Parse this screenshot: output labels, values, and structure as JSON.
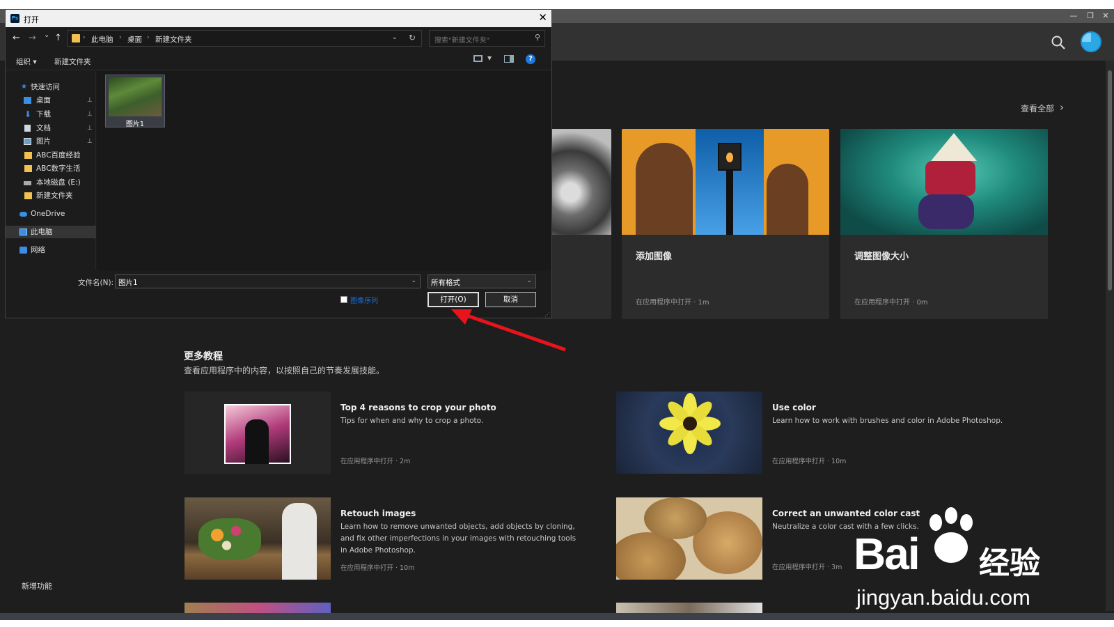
{
  "window": {
    "minimize_glyph": "—",
    "restore_glyph": "❐",
    "close_glyph": "✕"
  },
  "home": {
    "see_all": "查看全部",
    "cards": [
      {
        "title": "添加图像",
        "meta": "在应用程序中打开 · 1m"
      },
      {
        "title": "调整图像大小",
        "meta": "在应用程序中打开 · 0m"
      }
    ],
    "more_title": "更多教程",
    "more_subtitle": "查看应用程序中的内容，以按照自己的节奏发展技能。",
    "tutorials": [
      {
        "title": "Top 4 reasons to crop your photo",
        "desc": "Tips for when and why to crop a photo.",
        "meta": "在应用程序中打开 · 2m"
      },
      {
        "title": "Use color",
        "desc": "Learn how to work with brushes and color in Adobe Photoshop.",
        "meta": "在应用程序中打开 · 10m"
      },
      {
        "title": "Retouch images",
        "desc": "Learn how to remove unwanted objects, add objects by cloning, and fix other imperfections in your images with retouching tools in Adobe Photoshop.",
        "meta": "在应用程序中打开 · 10m"
      },
      {
        "title": "Correct an unwanted color cast",
        "desc": "Neutralize a color cast with a few clicks.",
        "meta": "在应用程序中打开 · 3m"
      }
    ],
    "new_features": "新增功能"
  },
  "dialog": {
    "app_icon": "Ps",
    "title": "打开",
    "close": "✕",
    "nav": {
      "back": "←",
      "forward": "→",
      "recent": "⌄",
      "up": "↑"
    },
    "breadcrumb": [
      "此电脑",
      "桌面",
      "新建文件夹"
    ],
    "search_placeholder": "搜索\"新建文件夹\"",
    "toolbar": {
      "organize": "组织 ▾",
      "new_folder": "新建文件夹",
      "help": "?"
    },
    "sidebar": [
      {
        "label": "快速访问",
        "pinned": false
      },
      {
        "label": "桌面",
        "pinned": true
      },
      {
        "label": "下载",
        "pinned": true
      },
      {
        "label": "文档",
        "pinned": true
      },
      {
        "label": "图片",
        "pinned": true
      },
      {
        "label": "ABC百度经验",
        "pinned": false
      },
      {
        "label": "ABC数字生活",
        "pinned": false
      },
      {
        "label": "本地磁盘 (E:)",
        "pinned": false
      },
      {
        "label": "新建文件夹",
        "pinned": false
      },
      {
        "label": "OneDrive",
        "pinned": false
      },
      {
        "label": "此电脑",
        "pinned": false
      },
      {
        "label": "网络",
        "pinned": false
      }
    ],
    "pin_glyph": "📌",
    "file": {
      "name": "图片1"
    },
    "filename_label": "文件名(N):",
    "filename_value": "图片1",
    "filetype_value": "所有格式",
    "sequence_label": "图像序列",
    "open_button": "打开(O)",
    "cancel_button": "取消"
  },
  "watermark": {
    "brand": "Bai",
    "brand2": "经验",
    "url": "jingyan.baidu.com"
  },
  "colors": {
    "accent": "#31a8ff",
    "dialog_bg": "#1c1c1c",
    "app_bg": "#1e1e1e",
    "arrow": "#e8141c"
  }
}
